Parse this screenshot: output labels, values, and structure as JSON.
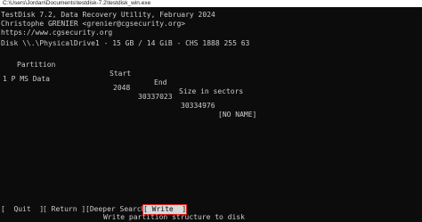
{
  "window": {
    "title": "C:\\Users\\Jordan\\Documents\\testdisk-7.2\\testdisk_win.exe"
  },
  "header_lines": [
    "TestDisk 7.2, Data Recovery Utility, February 2024",
    "Christophe GRENIER <grenier@cgsecurity.org>",
    "https://www.cgsecurity.org"
  ],
  "disk_line": "Disk \\\\.\\PhysicalDrive1 - 15 GB / 14 GiB - CHS 1888 255 63",
  "table": {
    "headers": [
      "Partition",
      "Start",
      "End",
      "Size in sectors"
    ],
    "rows": [
      {
        "partition": "1 P MS Data",
        "start": "2048",
        "end": "30337023",
        "size": "30334976",
        "name": "[NO NAME]"
      }
    ]
  },
  "menu": {
    "quit": "[  Quit  ]",
    "return": "[ Return ]",
    "deeper_search": "[Deeper Search]",
    "write": "[ Write  ]"
  },
  "hint": "Write partition structure to disk",
  "colors": {
    "background": "#0c0c0c",
    "text": "#cccccc",
    "selection_bg": "#d9d9d9",
    "highlight_border": "#e0201c"
  }
}
